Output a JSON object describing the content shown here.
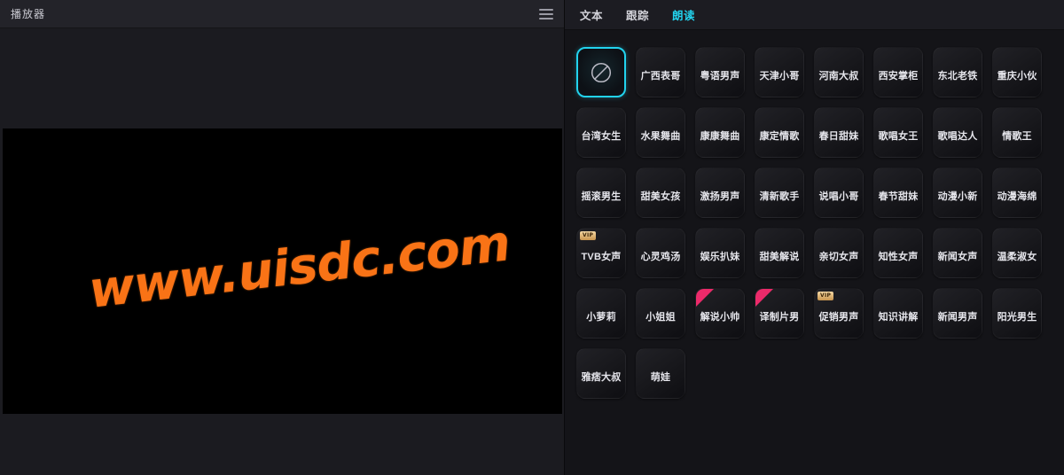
{
  "player": {
    "title": "播放器",
    "menu_icon": "hamburger-menu-icon",
    "watermark_text": "www.uisdc.com",
    "watermark_color": "#f97316",
    "cursor_icon": "pointing-hand-cursor-icon",
    "stage_background": "#000000"
  },
  "panel": {
    "accent_color": "#22d3ee",
    "left_background": "#1b1b20",
    "right_background": "#141418"
  },
  "tabs": [
    {
      "label": "文本",
      "active": false
    },
    {
      "label": "跟踪",
      "active": false
    },
    {
      "label": "朗读",
      "active": true
    }
  ],
  "voice_grid": {
    "badge_labels": {
      "vip": "VIP",
      "new": "new-corner-ribbon"
    },
    "items": [
      {
        "label": "",
        "icon": "no-voice-slash-icon",
        "selected": true,
        "badge": null
      },
      {
        "label": "广西表哥",
        "selected": false,
        "badge": null
      },
      {
        "label": "粤语男声",
        "selected": false,
        "badge": null
      },
      {
        "label": "天津小哥",
        "selected": false,
        "badge": null
      },
      {
        "label": "河南大叔",
        "selected": false,
        "badge": null
      },
      {
        "label": "西安掌柜",
        "selected": false,
        "badge": null
      },
      {
        "label": "东北老铁",
        "selected": false,
        "badge": null
      },
      {
        "label": "重庆小伙",
        "selected": false,
        "badge": null
      },
      {
        "label": "台湾女生",
        "selected": false,
        "badge": null
      },
      {
        "label": "水果舞曲",
        "selected": false,
        "badge": null
      },
      {
        "label": "康康舞曲",
        "selected": false,
        "badge": null
      },
      {
        "label": "康定情歌",
        "selected": false,
        "badge": null
      },
      {
        "label": "春日甜妹",
        "selected": false,
        "badge": null
      },
      {
        "label": "歌唱女王",
        "selected": false,
        "badge": null
      },
      {
        "label": "歌唱达人",
        "selected": false,
        "badge": null
      },
      {
        "label": "情歌王",
        "selected": false,
        "badge": null
      },
      {
        "label": "摇滚男生",
        "selected": false,
        "badge": null
      },
      {
        "label": "甜美女孩",
        "selected": false,
        "badge": null
      },
      {
        "label": "激扬男声",
        "selected": false,
        "badge": null
      },
      {
        "label": "清新歌手",
        "selected": false,
        "badge": null
      },
      {
        "label": "说唱小哥",
        "selected": false,
        "badge": null
      },
      {
        "label": "春节甜妹",
        "selected": false,
        "badge": null
      },
      {
        "label": "动漫小新",
        "selected": false,
        "badge": null
      },
      {
        "label": "动漫海绵",
        "selected": false,
        "badge": null
      },
      {
        "label": "TVB女声",
        "selected": false,
        "badge": "vip"
      },
      {
        "label": "心灵鸡汤",
        "selected": false,
        "badge": null
      },
      {
        "label": "娱乐扒妹",
        "selected": false,
        "badge": null
      },
      {
        "label": "甜美解说",
        "selected": false,
        "badge": null
      },
      {
        "label": "亲切女声",
        "selected": false,
        "badge": null
      },
      {
        "label": "知性女声",
        "selected": false,
        "badge": null
      },
      {
        "label": "新闻女声",
        "selected": false,
        "badge": null
      },
      {
        "label": "温柔淑女",
        "selected": false,
        "badge": null
      },
      {
        "label": "小萝莉",
        "selected": false,
        "badge": null
      },
      {
        "label": "小姐姐",
        "selected": false,
        "badge": null
      },
      {
        "label": "解说小帅",
        "selected": false,
        "badge": "new"
      },
      {
        "label": "译制片男",
        "selected": false,
        "badge": "new"
      },
      {
        "label": "促销男声",
        "selected": false,
        "badge": "vip"
      },
      {
        "label": "知识讲解",
        "selected": false,
        "badge": null
      },
      {
        "label": "新闻男声",
        "selected": false,
        "badge": null
      },
      {
        "label": "阳光男生",
        "selected": false,
        "badge": null
      },
      {
        "label": "雅痞大叔",
        "selected": false,
        "badge": null
      },
      {
        "label": "萌娃",
        "selected": false,
        "badge": null
      }
    ]
  }
}
